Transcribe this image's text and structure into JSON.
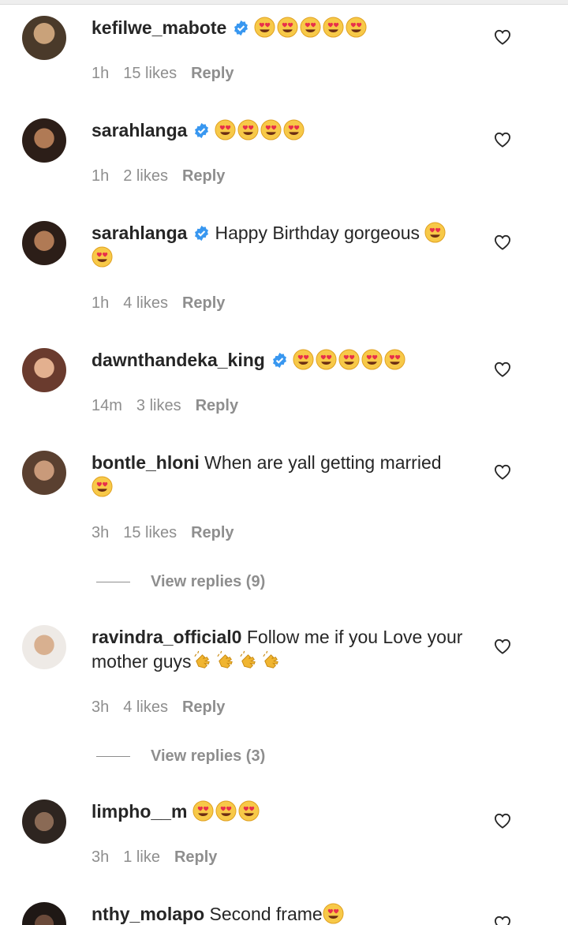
{
  "comments": [
    {
      "user": "kefilwe_mabote",
      "verified": true,
      "text": "",
      "emojis": 5,
      "time": "1h",
      "likes": "15 likes",
      "reply": "Reply"
    },
    {
      "user": "sarahlanga",
      "verified": true,
      "text": "",
      "emojis": 4,
      "time": "1h",
      "likes": "2 likes",
      "reply": "Reply"
    },
    {
      "user": "sarahlanga",
      "verified": true,
      "text": "Happy Birthday gorgeous",
      "emojis": 2,
      "time": "1h",
      "likes": "4 likes",
      "reply": "Reply"
    },
    {
      "user": "dawnthandeka_king",
      "verified": true,
      "text": "",
      "emojis": 5,
      "time": "14m",
      "likes": "3 likes",
      "reply": "Reply"
    },
    {
      "user": "bontle_hloni",
      "verified": false,
      "text": "When are yall getting married",
      "emojis": 1,
      "time": "3h",
      "likes": "15 likes",
      "reply": "Reply",
      "view_replies": "View replies (9)"
    },
    {
      "user": "ravindra_official0",
      "verified": false,
      "text": "Follow me if you Love your mother guys",
      "emojis": 0,
      "claps": 4,
      "time": "3h",
      "likes": "4 likes",
      "reply": "Reply",
      "view_replies": "View replies (3)"
    },
    {
      "user": "limpho__m",
      "verified": false,
      "text": "",
      "emojis": 3,
      "time": "3h",
      "likes": "1 like",
      "reply": "Reply"
    },
    {
      "user": "nthy_molapo",
      "verified": false,
      "text": "Second frame",
      "emojis": 1
    }
  ],
  "colors": {
    "verified": "#3897f0",
    "meta": "#8e8e8e",
    "text": "#262626"
  },
  "icons": {
    "like": "heart-outline-icon",
    "verified": "verified-badge-icon",
    "emoji": "heart-eyes-emoji",
    "clap": "clapping-hands-emoji"
  }
}
